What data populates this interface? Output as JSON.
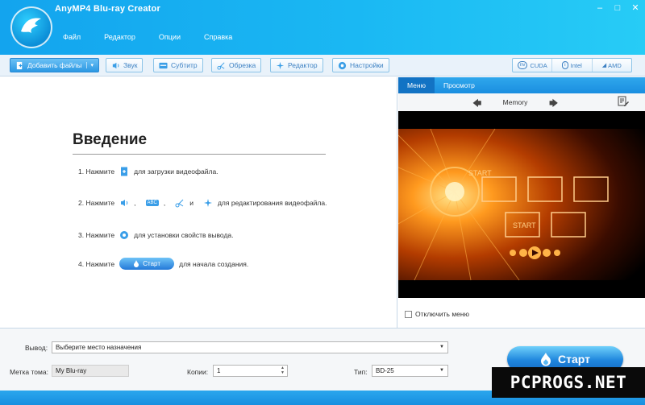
{
  "app": {
    "title": "AnyMP4 Blu-ray Creator",
    "menu": [
      "Файл",
      "Редактор",
      "Опции",
      "Справка"
    ],
    "window_controls": [
      "–",
      "□",
      "✕"
    ]
  },
  "toolbar": {
    "add_files": "Добавить файлы",
    "add_files_dropdown": "▾",
    "audio": "Звук",
    "subtitle": "Субтитр",
    "trim": "Обрезка",
    "editor": "Редактор",
    "settings": "Настройки",
    "hw": [
      {
        "mark": "nvidia",
        "label": "CUDA"
      },
      {
        "mark": "intel",
        "label": "Intel"
      },
      {
        "mark": "amd",
        "label": "AMD"
      }
    ]
  },
  "intro": {
    "title": "Введение",
    "step1_prefix": "1. Нажмите",
    "step1_suffix": "для загрузки видеофайла.",
    "step2_prefix": "2. Нажмите",
    "step2_comma1": ",",
    "step2_abc": "ABC",
    "step2_comma2": ",",
    "step2_and": "и",
    "step2_suffix": "для редактирования видеофайла.",
    "step3_prefix": "3. Нажмите",
    "step3_suffix": "для установки свойств вывода.",
    "step4_prefix": "4. Нажмите",
    "step4_button": "Старт",
    "step4_suffix": "для начала создания."
  },
  "right_panel": {
    "tabs": [
      "Меню",
      "Просмотр"
    ],
    "active_tab": "Меню",
    "prev_arrow": "🡄",
    "next_arrow": "🡆",
    "theme_name": "Memory",
    "preview_labels": [
      "START",
      "START"
    ],
    "disable_menu_label": "Отключить меню",
    "disable_menu_checked": false
  },
  "bottom": {
    "output_label": "Вывод:",
    "output_value": "Выберите место назначения",
    "volume_label": "Метка тома:",
    "volume_value": "My Blu-ray",
    "copies_label": "Копии:",
    "copies_value": "1",
    "type_label": "Тип:",
    "type_value": "BD-25",
    "start_label": "Старт"
  },
  "watermark": "PCPROGS.NET",
  "colors": {
    "header_start": "#13a4ee",
    "header_end": "#27ccf6",
    "accent": "#2b98e3",
    "toolbar_text": "#3b7fc2"
  }
}
